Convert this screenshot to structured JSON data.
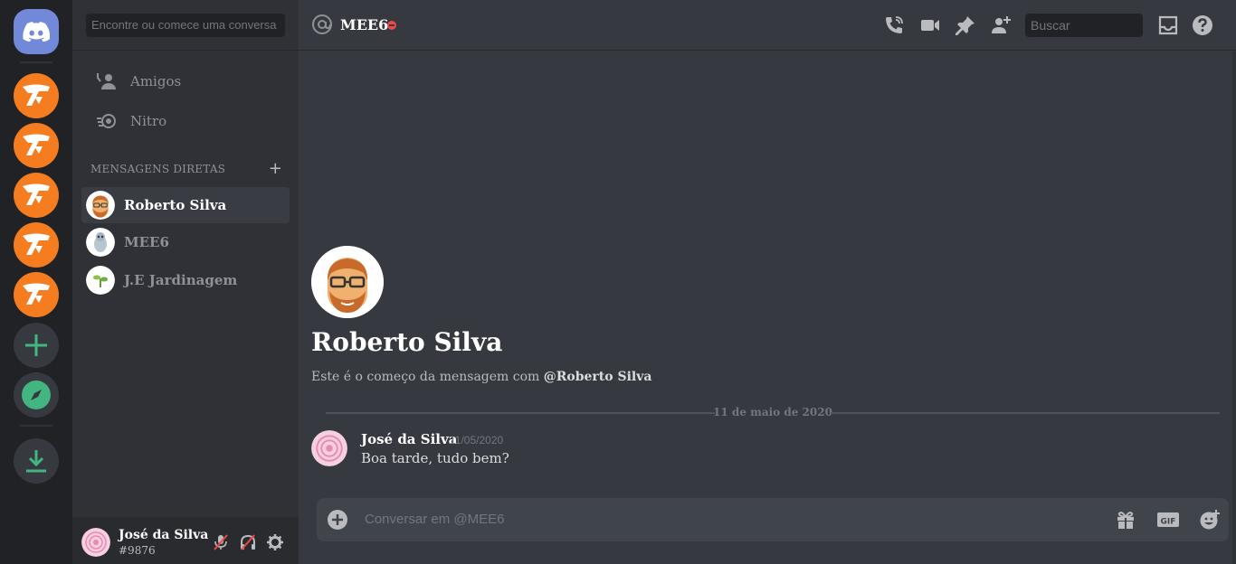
{
  "colors": {
    "blurple": "#7289da",
    "server_orange": "#f57c1f",
    "green": "#43b581",
    "dnd": "#f04747"
  },
  "guilds": {
    "home_icon": "discord-logo-icon",
    "servers": [
      "server-icon",
      "server-icon",
      "server-icon",
      "server-icon",
      "server-icon"
    ],
    "add_icon": "plus-icon",
    "explore_icon": "compass-icon",
    "download_icon": "download-icon"
  },
  "sidebar": {
    "search_placeholder": "Encontre ou comece uma conversa",
    "nav": [
      {
        "label": "Amigos",
        "icon": "friends-icon"
      },
      {
        "label": "Nitro",
        "icon": "nitro-icon"
      }
    ],
    "dm_header": "MENSAGENS DIRETAS",
    "dm_add": "+",
    "dms": [
      {
        "name": "Roberto Silva",
        "icon": "avatar-roberto"
      },
      {
        "name": "MEE6",
        "icon": "avatar-mee6"
      },
      {
        "name": "J.E Jardinagem",
        "icon": "avatar-jardinagem"
      }
    ]
  },
  "user": {
    "name": "José da Silva",
    "tag": "#9876"
  },
  "header": {
    "title": "MEE6",
    "search_placeholder": "Buscar",
    "icons": [
      "call-icon",
      "video-icon",
      "pin-icon",
      "add-member-icon",
      "inbox-icon",
      "help-icon"
    ]
  },
  "chat": {
    "profile_name": "Roberto Silva",
    "intro_text": "Este é o começo da mensagem com ",
    "intro_mention": "@Roberto Silva",
    "date_divider": "11 de maio de 2020",
    "messages": [
      {
        "author": "José da Silva",
        "time": "11/05/2020",
        "text": "Boa tarde, tudo bem?"
      }
    ],
    "composer_placeholder": "Conversar em @MEE6",
    "composer_icons": [
      "add-circle-icon",
      "gift-icon",
      "gif-icon",
      "emoji-icon"
    ]
  }
}
